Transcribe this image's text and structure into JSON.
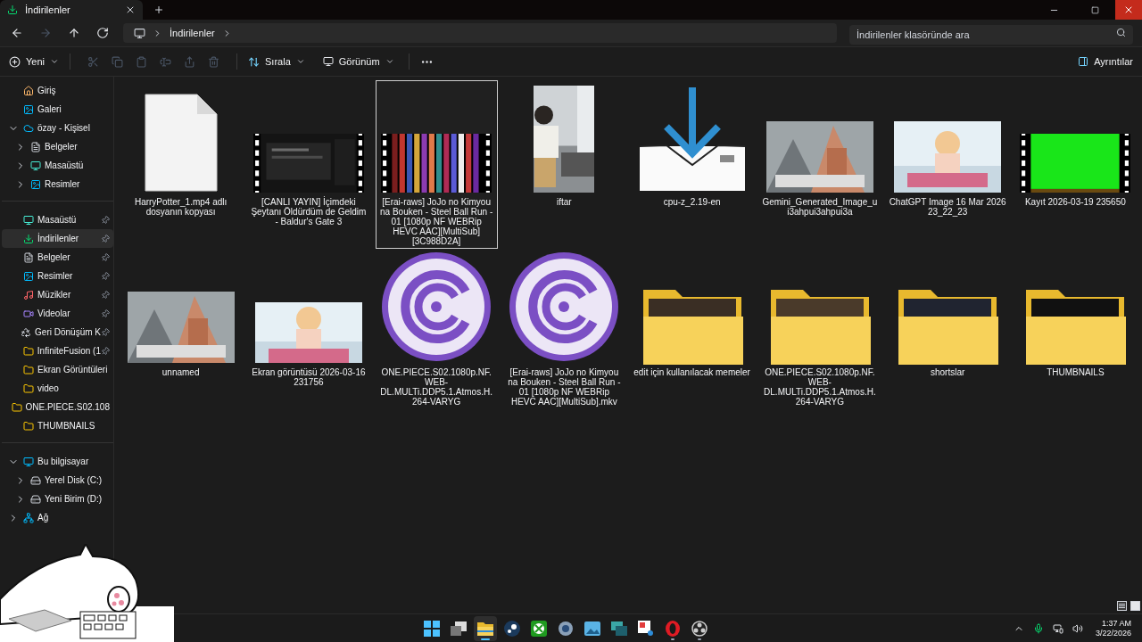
{
  "tab": {
    "title": "İndirilenler"
  },
  "nav_buttons": [
    {
      "kind": "back",
      "disabled": false
    },
    {
      "kind": "forward",
      "disabled": true
    },
    {
      "kind": "up",
      "disabled": false
    },
    {
      "kind": "refresh",
      "disabled": false
    }
  ],
  "address": {
    "segments": [
      "İndirilenler"
    ]
  },
  "search": {
    "placeholder": "İndirilenler klasöründe ara"
  },
  "toolbar": {
    "new": "Yeni",
    "actions": [
      {
        "kind": "cut",
        "disabled": true
      },
      {
        "kind": "copy",
        "disabled": true
      },
      {
        "kind": "paste",
        "disabled": true
      },
      {
        "kind": "rename",
        "disabled": true
      },
      {
        "kind": "share",
        "disabled": true
      },
      {
        "kind": "delete",
        "disabled": true
      }
    ],
    "sort": "Sırala",
    "view": "Görünüm",
    "details": "Ayrıntılar"
  },
  "sidebar": {
    "groups": [
      [
        {
          "label": "Giriş",
          "selected": false
        },
        {
          "label": "Galeri",
          "selected": false
        },
        {
          "label": "özay - Kişisel",
          "selected": false,
          "expanded": true,
          "children": [
            {
              "label": "Belgeler",
              "selected": false,
              "expanded": false
            },
            {
              "label": "Masaüstü",
              "selected": false,
              "expanded": false
            },
            {
              "label": "Resimler",
              "selected": false,
              "expanded": false
            }
          ]
        }
      ],
      [
        {
          "label": "Masaüstü",
          "selected": false,
          "pinned": true
        },
        {
          "label": "İndirilenler",
          "selected": true,
          "pinned": true
        },
        {
          "label": "Belgeler",
          "selected": false,
          "pinned": true
        },
        {
          "label": "Resimler",
          "selected": false,
          "pinned": true
        },
        {
          "label": "Müzikler",
          "selected": false,
          "pinned": true
        },
        {
          "label": "Videolar",
          "selected": false,
          "pinned": true
        },
        {
          "label": "Geri Dönüşüm K",
          "selected": false,
          "pinned": true
        },
        {
          "label": "InfiniteFusion (1",
          "selected": false,
          "pinned": true
        },
        {
          "label": "Ekran Görüntüleri",
          "selected": false,
          "pinned": false
        },
        {
          "label": "video",
          "selected": false,
          "pinned": false
        },
        {
          "label": "ONE.PIECE.S02.108",
          "selected": false,
          "pinned": false
        },
        {
          "label": "THUMBNAILS",
          "selected": false,
          "pinned": false
        }
      ],
      [
        {
          "label": "Bu bilgisayar",
          "selected": false,
          "expanded": true,
          "children": [
            {
              "label": "Yerel Disk (C:)",
              "selected": false,
              "expanded": false
            },
            {
              "label": "Yeni Birim (D:)",
              "selected": false,
              "expanded": false
            }
          ]
        },
        {
          "label": "Ağ",
          "selected": false,
          "expanded": false
        }
      ]
    ]
  },
  "items": [
    {
      "kind": "document",
      "name": "HarryPotter_1.mp4 adlı dosyanın kopyası",
      "selected": false
    },
    {
      "kind": "video",
      "name": "[CANLI YAYIN]  İçimdeki Şeytanı Öldürdüm de Geldim - Baldur's Gate 3",
      "selected": false
    },
    {
      "kind": "video",
      "name": "[Erai-raws] JoJo no Kimyou na Bouken - Steel Ball Run - 01 [1080p NF WEBRip HEVC AAC][MultiSub][3C988D2A]",
      "selected": true
    },
    {
      "name": "iftar",
      "selected": false
    },
    {
      "kind": "installer",
      "name": "cpu-z_2.19-en",
      "selected": false
    },
    {
      "name": "Gemini_Generated_Image_ui3ahpui3ahpui3a",
      "selected": false
    },
    {
      "name": "ChatGPT Image 16 Mar 2026 23_22_23",
      "selected": false
    },
    {
      "kind": "video",
      "name": "Kayıt 2026-03-19 235650",
      "selected": false
    },
    {
      "name": "unnamed",
      "selected": false
    },
    {
      "name": "Ekran görüntüsü 2026-03-16 231756",
      "selected": false
    },
    {
      "kind": "torrent",
      "name": "ONE.PIECE.S02.1080p.NF.WEB-DL.MULTi.DDP5.1.Atmos.H.264-VARYG",
      "selected": false
    },
    {
      "kind": "torrent",
      "name": "[Erai-raws] JoJo no Kimyou na Bouken - Steel Ball Run - 01 [1080p NF WEBRip HEVC AAC][MultiSub].mkv",
      "selected": false
    },
    {
      "kind": "folder",
      "name": "edit için kullanılacak memeler",
      "selected": false
    },
    {
      "kind": "folder",
      "name": "ONE.PIECE.S02.1080p.NF.WEB-DL.MULTi.DDP5.1.Atmos.H.264-VARYG",
      "selected": false
    },
    {
      "kind": "folder",
      "name": "shortslar",
      "selected": false
    },
    {
      "kind": "folder",
      "name": "THUMBNAILS",
      "selected": false
    }
  ],
  "view_buttons": [
    {
      "kind": "details",
      "selected": false
    },
    {
      "kind": "large-icons",
      "selected": true
    }
  ],
  "taskbar": {
    "apps": [
      {
        "kind": "start",
        "active": false,
        "running": false
      },
      {
        "kind": "task-view",
        "active": false,
        "running": false
      },
      {
        "kind": "explorer",
        "active": true,
        "running": true
      },
      {
        "kind": "steam",
        "active": false,
        "running": false
      },
      {
        "kind": "xbox",
        "active": false,
        "running": false
      },
      {
        "kind": "settings",
        "active": false,
        "running": false
      },
      {
        "kind": "photos",
        "active": false,
        "running": false
      },
      {
        "kind": "windows",
        "active": false,
        "running": false
      },
      {
        "kind": "snip",
        "active": false,
        "running": false
      },
      {
        "kind": "opera",
        "active": false,
        "running": true
      },
      {
        "kind": "obs",
        "active": false,
        "running": true
      }
    ],
    "time": "1:37 AM",
    "date": "3/22/2026"
  }
}
